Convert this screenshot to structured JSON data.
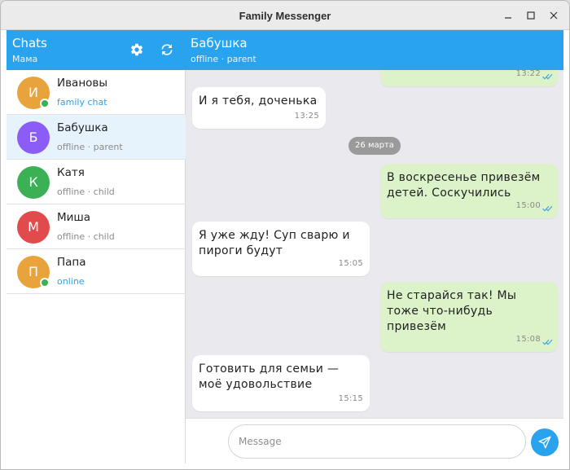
{
  "window": {
    "title": "Family Messenger"
  },
  "sidebar": {
    "title": "Chats",
    "user": "Мама",
    "chats": [
      {
        "initial": "И",
        "name": "Ивановы",
        "status": "family chat",
        "online": true,
        "color": "#e8a33d"
      },
      {
        "initial": "Б",
        "name": "Бабушка",
        "status": "offline · parent",
        "online": false,
        "color": "#8b5cf6",
        "active": true
      },
      {
        "initial": "К",
        "name": "Катя",
        "status": "offline · child",
        "online": false,
        "color": "#3cb054"
      },
      {
        "initial": "М",
        "name": "Миша",
        "status": "offline · child",
        "online": false,
        "color": "#e24b4b"
      },
      {
        "initial": "П",
        "name": "Папа",
        "status": "online",
        "online": true,
        "color": "#e8a33d"
      }
    ]
  },
  "conversation": {
    "name": "Бабушка",
    "status": "offline · parent",
    "date_separator": "26 марта",
    "messages": [
      {
        "direction": "out",
        "text": "",
        "time": "13:22",
        "read": true
      },
      {
        "direction": "in",
        "text": "И я тебя, доченька",
        "time": "13:25"
      },
      {
        "direction": "out",
        "text": "В воскресенье привезём детей. Соскучились",
        "time": "15:00",
        "read": true
      },
      {
        "direction": "in",
        "text": "Я уже жду! Суп сварю и пироги будут",
        "time": "15:05"
      },
      {
        "direction": "out",
        "text": "Не старайся так! Мы тоже что-нибудь привезём",
        "time": "15:08",
        "read": true
      },
      {
        "direction": "in",
        "text": "Готовить для семьи — моё удовольствие",
        "time": "15:15"
      }
    ]
  },
  "composer": {
    "placeholder": "Message",
    "value": ""
  },
  "colors": {
    "accent": "#2aa3ef",
    "outgoing_bubble": "#dcf3c9",
    "incoming_bubble": "#ffffff",
    "online": "#3cb054"
  },
  "icons": {
    "settings": "gear-icon",
    "refresh": "refresh-icon",
    "send": "send-icon",
    "read": "double-check-icon"
  }
}
